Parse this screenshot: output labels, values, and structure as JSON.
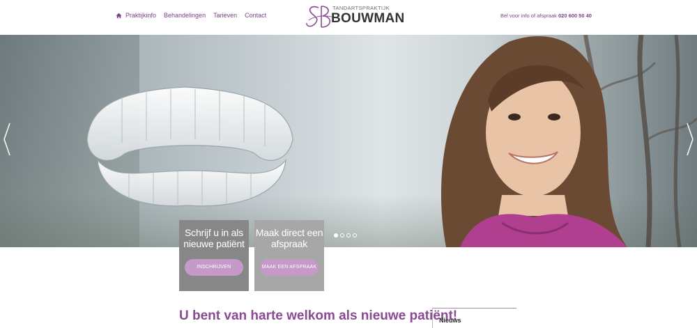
{
  "nav": {
    "items": [
      {
        "label": "Praktijkinfo",
        "icon": "home-icon"
      },
      {
        "label": "Behandelingen"
      },
      {
        "label": "Tarieven"
      },
      {
        "label": "Contact"
      }
    ]
  },
  "logo": {
    "subtitle": "TANDARTSPRAKTIJK",
    "name": "BOUWMAN"
  },
  "phone": {
    "label": "Bel voor info of afspraak",
    "number": "020 600 50 40"
  },
  "slider": {
    "dots": 4,
    "active_index": 0
  },
  "cta": [
    {
      "title": "Schrijf u in als nieuwe patiënt",
      "button": "INSCHRIJVEN"
    },
    {
      "title": "Maak direct een afspraak",
      "button": "MAAK EEN AFSPRAAK"
    }
  ],
  "content": {
    "welcome": "U bent van harte welkom als nieuwe patiënt!"
  },
  "sidebar": {
    "news_title": "Nieuws"
  },
  "colors": {
    "accent": "#7a3f87",
    "button": "#c59ac9",
    "cta_dark": "#878787",
    "cta_light": "#a7a7a7"
  }
}
